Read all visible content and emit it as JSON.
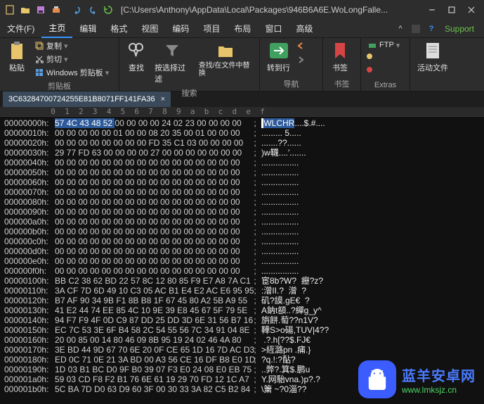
{
  "titlebar": {
    "path": "[C:\\Users\\Anthony\\AppData\\Local\\Packages\\946B6A6E.WoLongFalle..."
  },
  "menu": {
    "items": [
      "文件(F)",
      "主页",
      "编辑",
      "格式",
      "视图",
      "编码",
      "项目",
      "布局",
      "窗口",
      "高级"
    ],
    "active_index": 1,
    "support": "Support"
  },
  "ribbon": {
    "paste": {
      "label": "粘贴"
    },
    "copy": {
      "label": "复制"
    },
    "cut": {
      "label": "剪切"
    },
    "clipboard_mode": {
      "label": "Windows 剪贴板"
    },
    "group_clipboard": "剪贴板",
    "find": {
      "label": "查找"
    },
    "filter": {
      "label": "按选择过滤"
    },
    "find_replace": {
      "label": "查找/在文件中替换"
    },
    "group_search": "搜索",
    "goto": {
      "label": "转到行"
    },
    "group_nav": "导航",
    "bookmark": {
      "label": "书签"
    },
    "group_bookmark": "书签",
    "ftp": {
      "label": "FTP"
    },
    "group_extras": "Extras",
    "active_file": {
      "label": "活动文件"
    }
  },
  "tab": {
    "name": "3C63284700724255E81B8071FF141FA36",
    "close": "×"
  },
  "ruler": "          0  1  2  3  4  5  6  7  8  9  a  b  c  d  e  f",
  "hex": [
    {
      "a": "00000000h:",
      "b": "57 4C 43 48 52 00 00 00 00 24 02 23 00 00 00 00",
      "s": ";",
      "t": "WLCHR....$.#....",
      "hl_start": 0,
      "hl_end": 5
    },
    {
      "a": "00000010h:",
      "b": "00 00 00 00 00 01 00 00 08 20 35 00 01 00 00 00",
      "s": ";",
      "t": "......... 5....."
    },
    {
      "a": "00000020h:",
      "b": "00 00 00 00 00 00 00 00 FD 35 C1 03 00 00 00 00",
      "s": ";",
      "t": ".......??......"
    },
    {
      "a": "00000030h:",
      "b": "29 77 FD 63 00 00 00 00 27 00 00 00 00 00 00 00",
      "s": ";",
      "t": ")w韈....'......."
    },
    {
      "a": "00000040h:",
      "b": "00 00 00 00 00 00 00 00 00 00 00 00 00 00 00 00",
      "s": ";",
      "t": "................"
    },
    {
      "a": "00000050h:",
      "b": "00 00 00 00 00 00 00 00 00 00 00 00 00 00 00 00",
      "s": ";",
      "t": "................"
    },
    {
      "a": "00000060h:",
      "b": "00 00 00 00 00 00 00 00 00 00 00 00 00 00 00 00",
      "s": ";",
      "t": "................"
    },
    {
      "a": "00000070h:",
      "b": "00 00 00 00 00 00 00 00 00 00 00 00 00 00 00 00",
      "s": ";",
      "t": "................"
    },
    {
      "a": "00000080h:",
      "b": "00 00 00 00 00 00 00 00 00 00 00 00 00 00 00 00",
      "s": ";",
      "t": "................"
    },
    {
      "a": "00000090h:",
      "b": "00 00 00 00 00 00 00 00 00 00 00 00 00 00 00 00",
      "s": ";",
      "t": "................"
    },
    {
      "a": "000000a0h:",
      "b": "00 00 00 00 00 00 00 00 00 00 00 00 00 00 00 00",
      "s": ";",
      "t": "................"
    },
    {
      "a": "000000b0h:",
      "b": "00 00 00 00 00 00 00 00 00 00 00 00 00 00 00 00",
      "s": ";",
      "t": "................"
    },
    {
      "a": "000000c0h:",
      "b": "00 00 00 00 00 00 00 00 00 00 00 00 00 00 00 00",
      "s": ";",
      "t": "................"
    },
    {
      "a": "000000d0h:",
      "b": "00 00 00 00 00 00 00 00 00 00 00 00 00 00 00 00",
      "s": ";",
      "t": "................"
    },
    {
      "a": "000000e0h:",
      "b": "00 00 00 00 00 00 00 00 00 00 00 00 00 00 00 00",
      "s": ";",
      "t": "................"
    },
    {
      "a": "000000f0h:",
      "b": "00 00 00 00 00 00 00 00 00 00 00 00 00 00 00 00",
      "s": ";",
      "t": "................"
    },
    {
      "a": "00000100h:",
      "b": "BB C2 38 62 BD 22 57 8C 12 80 85 F9 E7 A8 7A C1",
      "s": ";",
      "t": "宦8b?W?  癧?z?"
    },
    {
      "a": "00000110h:",
      "b": "3A CF 7D 6D 49 10 C3 05 AC B1 E4 E2 AC E6 95 95",
      "s": ";",
      "t": ":潧II.?  潧  ?"
    },
    {
      "a": "00000120h:",
      "b": "B7 AF 90 34 9B F1 8B B8 1F 67 45 80 A2 5B A9 55",
      "s": ";",
      "t": "矶?謨.gE€  ?"
    },
    {
      "a": "00000130h:",
      "b": "41 E2 44 74 EE 85 4C 10 9E 39 E8 45 67 5F 79 5E",
      "s": ";",
      "t": "A鈉t頟..?繟g_y^"
    },
    {
      "a": "00000140h:",
      "b": "94 F7 F9 4F 0D C9 87 DD 25 DD 3D 6E 31 56 B7 16",
      "s": ";",
      "t": "旃餅.萄??n1V?"
    },
    {
      "a": "00000150h:",
      "b": "EC 7C 53 3E 6F B4 58 2C 54 55 56 7C 34 91 04 8E",
      "s": ";",
      "t": "鞾S>o碭,TUV|4??"
    },
    {
      "a": "00000160h:",
      "b": "20 00 85 00 14 80 46 09 8B 95 19 24 02 46 4A 80",
      "s": ";",
      "t": " .?.h[??$.FJ€"
    },
    {
      "a": "00000170h:",
      "b": "3E BD 44 9D 67 70 6E 20 0F CE 65 1D 16 7D AC D3",
      "s": ";",
      "t": ">絚潞pn .痡.}"
    },
    {
      "a": "00000180h:",
      "b": "ED 0C 71 0E 21 3A BD 00 A3 56 CE 16 DF B8 E0 1D",
      "s": ";",
      "t": "?q.!:?酟?"
    },
    {
      "a": "00000190h:",
      "b": "1D 03 B1 BC D0 9F B0 39 07 F3 E0 24 08 E0 EB 75",
      "s": ";",
      "t": "..弊?.箕$.鹏u"
    },
    {
      "a": "000001a0h:",
      "b": "59 03 CD F8 F2 B1 76 6E 61 19 29 70 FD 12 1C A7",
      "s": ";",
      "t": "Y.网駘vna.)p?.?"
    },
    {
      "a": "000001b0h:",
      "b": "5C BA 7D D0 63 D9 60 3F 00 30 33 3A 82 C5 B2 84",
      "s": ";",
      "t": "\\簘 ~?0淄??"
    }
  ],
  "watermark": {
    "brand": "蓝羊安卓网",
    "url": "www.lmksjz.cn"
  }
}
